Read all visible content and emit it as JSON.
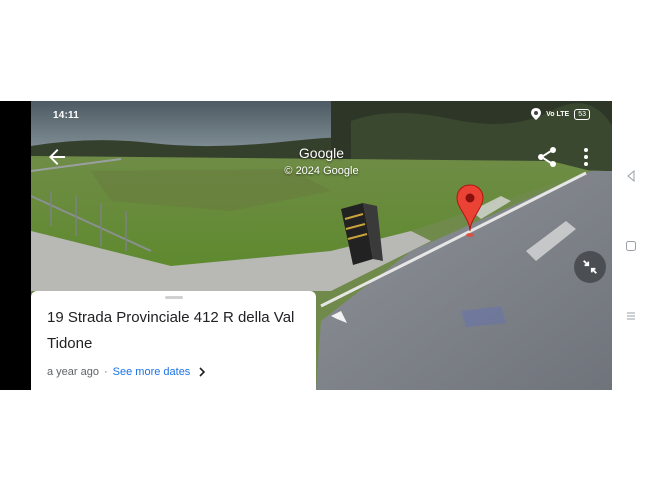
{
  "status_bar": {
    "time": "14:11",
    "signal_text": "Vo LTE",
    "battery": "53"
  },
  "header": {
    "title": "Google",
    "copyright": "© 2024 Google"
  },
  "place_card": {
    "address": "19 Strada Provinciale 412 R della Val Tidone",
    "age": "a year ago",
    "separator": "·",
    "see_more": "See more dates"
  },
  "colors": {
    "pin": "#ea4335",
    "link": "#1a73e8",
    "card_bg": "#ffffff"
  },
  "icons": {
    "back": "arrow-left",
    "share": "share",
    "more": "dots-vertical",
    "collapse": "arrows-in",
    "nav_back": "triangle-left",
    "nav_home": "square",
    "nav_recents": "lines"
  }
}
